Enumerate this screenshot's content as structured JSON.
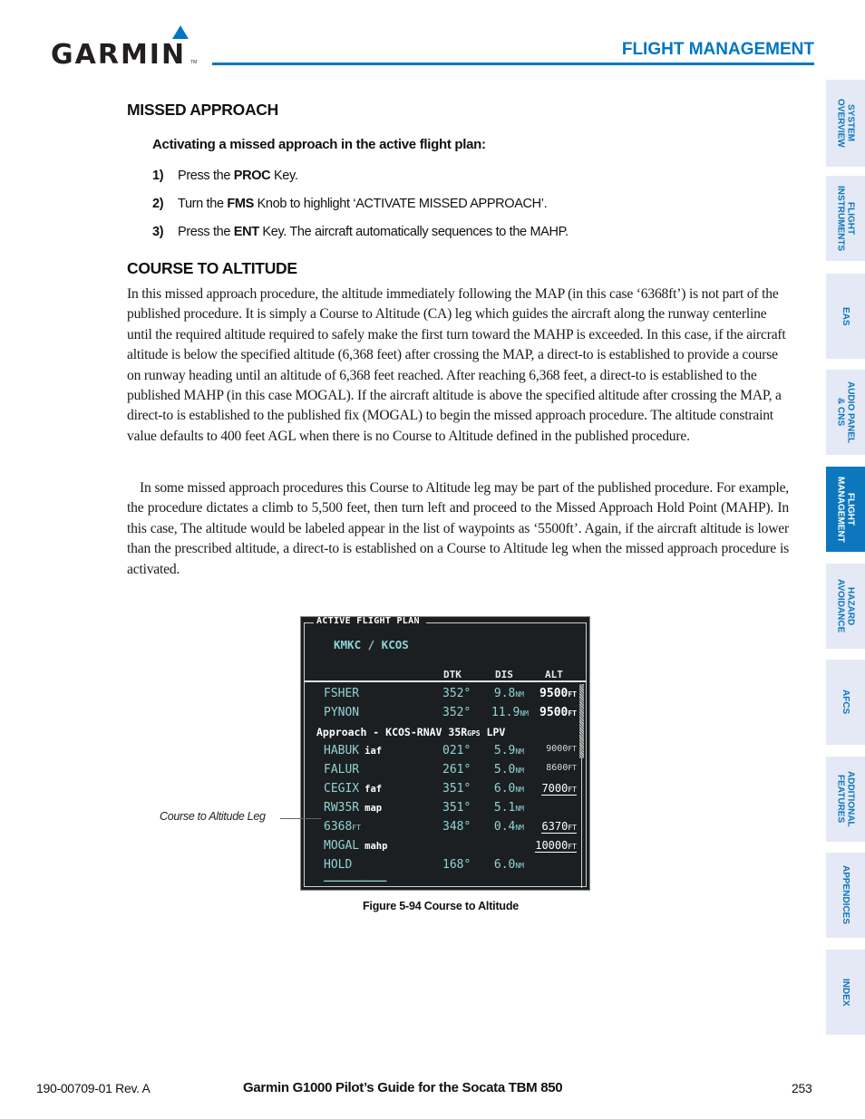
{
  "header": {
    "brand": "GARMIN",
    "brand_tm": "TM",
    "brand_color": "#0077c0",
    "section_title": "FLIGHT MANAGEMENT"
  },
  "side_tabs": [
    {
      "label": "SYSTEM\nOVERVIEW",
      "active": false
    },
    {
      "label": "FLIGHT\nINSTRUMENTS",
      "active": false
    },
    {
      "label": "EAS",
      "active": false
    },
    {
      "label": "AUDIO PANEL\n& CNS",
      "active": false
    },
    {
      "label": "FLIGHT\nMANAGEMENT",
      "active": true
    },
    {
      "label": "HAZARD\nAVOIDANCE",
      "active": false
    },
    {
      "label": "AFCS",
      "active": false
    },
    {
      "label": "ADDITIONAL\nFEATURES",
      "active": false
    },
    {
      "label": "APPENDICES",
      "active": false
    },
    {
      "label": "INDEX",
      "active": false
    }
  ],
  "missed_approach": {
    "heading": "MISSED APPROACH",
    "procedure_title": "Activating a missed approach in the active flight plan:",
    "steps": [
      {
        "num": "1)",
        "pre": "Press the ",
        "key": "PROC",
        "post": " Key."
      },
      {
        "num": "2)",
        "pre": "Turn the ",
        "key": "FMS",
        "post": " Knob to highlight ‘ACTIVATE MISSED APPROACH’."
      },
      {
        "num": "3)",
        "pre": "Press the ",
        "key": "ENT",
        "post": " Key.  The aircraft automatically sequences to the MAHP."
      }
    ]
  },
  "course_to_altitude": {
    "heading": "COURSE TO ALTITUDE",
    "paragraph_1": "In this missed approach procedure, the altitude immediately following the MAP (in this case ‘6368ft’) is not part of the published procedure. It is simply a Course to Altitude (CA) leg which guides the aircraft along the runway centerline until the required altitude required to safely make the first turn toward the MAHP is exceeded. In this case, if the aircraft altitude is below the specified altitude (6,368 feet) after crossing the MAP, a direct-to is established to provide a course on runway heading until an altitude of 6,368 feet reached. After reaching 6,368 feet, a direct-to is established to the published MAHP (in this case MOGAL). If the aircraft altitude is above the specified altitude after crossing the MAP, a direct-to is established to the published fix (MOGAL) to begin the missed approach procedure. The altitude constraint value defaults to 400 feet AGL when there is no Course to Altitude defined in the published procedure.",
    "paragraph_2": "In some missed approach procedures this Course to Altitude leg may be part of the published procedure. For example, the procedure dictates a climb to 5,500 feet, then turn left and proceed to the Missed Approach Hold Point (MAHP). In this case, The altitude would be labeled appear in the list of waypoints as ‘5500ft’. Again, if the aircraft altitude is lower than the prescribed altitude, a direct-to is established on a Course to Altitude leg when the missed approach procedure is activated."
  },
  "figure": {
    "window_title": "ACTIVE FLIGHT PLAN",
    "route": "KMKC / KCOS",
    "columns": {
      "dtk": "DTK",
      "dis": "DIS",
      "alt": "ALT"
    },
    "approach_label": {
      "main": "Approach - KCOS-RNAV 35R",
      "gps": "GPS",
      "suffix": " LPV"
    },
    "rows": [
      {
        "wpt": "FSHER",
        "tag": "",
        "dtk": "352°",
        "dis": "9.8",
        "dis_unit": "NM",
        "alt": "9500",
        "alt_unit": "FT",
        "style": "big"
      },
      {
        "wpt": "PYNON",
        "tag": "",
        "dtk": "352°",
        "dis": "11.9",
        "dis_unit": "NM",
        "alt": "9500",
        "alt_unit": "FT",
        "style": "big"
      },
      {
        "wpt": "HABUK",
        "tag": "iaf",
        "dtk": "021°",
        "dis": "5.9",
        "dis_unit": "NM",
        "alt": "9000",
        "alt_unit": "FT",
        "style": "small"
      },
      {
        "wpt": "FALUR",
        "tag": "",
        "dtk": "261°",
        "dis": "5.0",
        "dis_unit": "NM",
        "alt": "8600",
        "alt_unit": "FT",
        "style": "small"
      },
      {
        "wpt": "CEGIX",
        "tag": "faf",
        "dtk": "351°",
        "dis": "6.0",
        "dis_unit": "NM",
        "alt": "7000",
        "alt_unit": "FT",
        "style": "ul"
      },
      {
        "wpt": "RW35R",
        "tag": "map",
        "dtk": "351°",
        "dis": "5.1",
        "dis_unit": "NM",
        "alt": "",
        "alt_unit": "",
        "style": ""
      },
      {
        "wpt": "6368",
        "wpt_unit": "FT",
        "tag": "",
        "dtk": "348°",
        "dis": "0.4",
        "dis_unit": "NM",
        "alt": "6370",
        "alt_unit": "FT",
        "style": "ul"
      },
      {
        "wpt": "MOGAL",
        "tag": "mahp",
        "dtk": "",
        "dis": "",
        "dis_unit": "",
        "alt": "10000",
        "alt_unit": "FT",
        "style": "ul"
      },
      {
        "wpt": "HOLD",
        "tag": "",
        "dtk": "168°",
        "dis": "6.0",
        "dis_unit": "NM",
        "alt": "",
        "alt_unit": "",
        "style": ""
      }
    ],
    "end_marker": "__________",
    "callout": "Course to Altitude Leg",
    "caption": "Figure 5-94  Course to Altitude"
  },
  "footer": {
    "doc_number": "190-00709-01  Rev. A",
    "title": "Garmin G1000 Pilot’s Guide for the Socata TBM 850",
    "page": "253"
  }
}
